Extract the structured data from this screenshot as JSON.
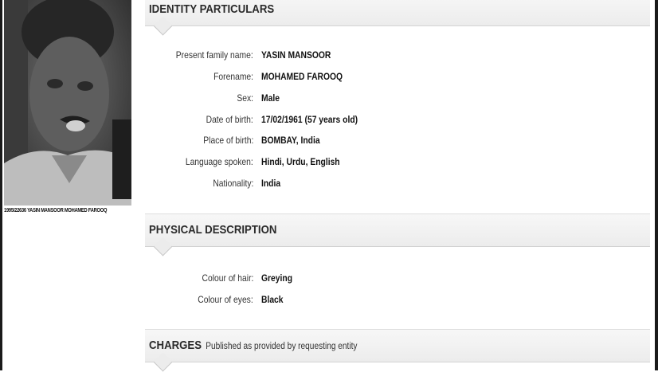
{
  "photo": {
    "caption": "1995/22636 YASIN MANSOOR MOHAMED FAROOQ"
  },
  "identity": {
    "title": "IDENTITY PARTICULARS",
    "rows": [
      {
        "label": "Present family name:",
        "value": "YASIN MANSOOR"
      },
      {
        "label": "Forename:",
        "value": "MOHAMED FAROOQ"
      },
      {
        "label": "Sex:",
        "value": "Male"
      },
      {
        "label": "Date of birth:",
        "value": "17/02/1961 (57 years old)"
      },
      {
        "label": "Place of birth:",
        "value": "BOMBAY, India"
      },
      {
        "label": "Language spoken:",
        "value": "Hindi, Urdu, English"
      },
      {
        "label": "Nationality:",
        "value": "India"
      }
    ]
  },
  "physical": {
    "title": "PHYSICAL DESCRIPTION",
    "rows": [
      {
        "label": "Colour of hair:",
        "value": "Greying"
      },
      {
        "label": "Colour of eyes:",
        "value": "Black"
      }
    ]
  },
  "charges": {
    "title": "CHARGES",
    "subtitle": "Published as provided by requesting entity"
  }
}
